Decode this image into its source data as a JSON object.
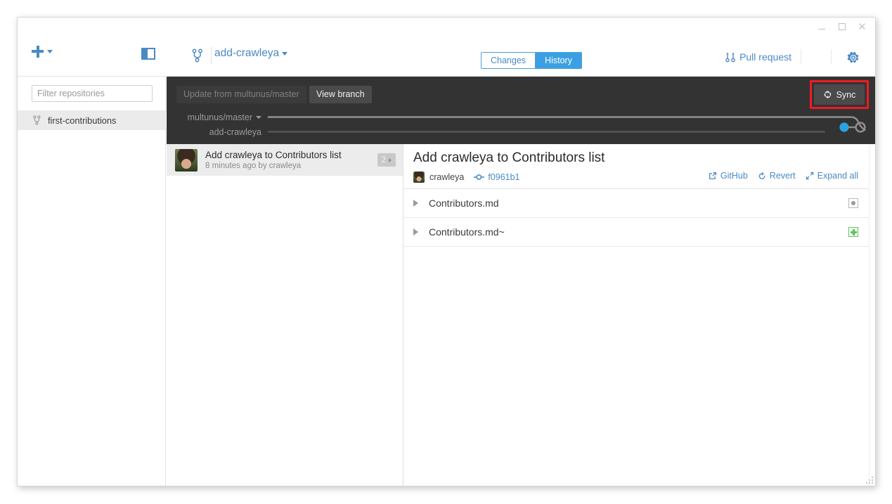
{
  "window": {
    "controls": {
      "minimize": "minimize",
      "maximize": "maximize",
      "close": "✕"
    }
  },
  "sidebar": {
    "add_repo": {
      "icon": "plus-icon",
      "caret": "chevron-down-icon"
    },
    "toggle_icon": "sidebar-toggle-icon",
    "filter": {
      "placeholder": "Filter repositories",
      "value": ""
    },
    "repos": [
      {
        "name": "first-contributions",
        "icon": "branch-icon",
        "selected": true
      }
    ]
  },
  "header": {
    "branch_icon": "branch-icon",
    "current_branch": "add-crawleya",
    "branch_caret": "chevron-down-icon",
    "tabs": [
      {
        "label": "Changes",
        "active": false
      },
      {
        "label": "History",
        "active": true
      }
    ],
    "pull_request": {
      "label": "Pull request",
      "icon": "pull-request-icon"
    },
    "settings_icon": "gear-icon"
  },
  "toolbar": {
    "update_button": {
      "label": "Update from multunus/master",
      "enabled": false
    },
    "view_branch_button": {
      "label": "View branch",
      "enabled": true
    },
    "sync_button": {
      "label": "Sync",
      "icon": "sync-icon",
      "highlighted": true,
      "highlight_color": "#ee1b24"
    }
  },
  "graph": {
    "rows": [
      {
        "label": "multunus/master",
        "has_caret": true
      },
      {
        "label": "add-crawleya",
        "has_caret": false
      }
    ],
    "commit_node_color": "#29a3e3"
  },
  "commits": [
    {
      "title": "Add crawleya to Contributors list",
      "meta": "8 minutes ago by crawleya",
      "badge": "2",
      "selected": true
    }
  ],
  "detail": {
    "title": "Add crawleya to Contributors list",
    "author": "crawleya",
    "sha": "f0961b1",
    "sha_icon": "commit-icon",
    "actions": [
      {
        "label": "GitHub",
        "icon": "external-link-icon"
      },
      {
        "label": "Revert",
        "icon": "revert-icon"
      },
      {
        "label": "Expand all",
        "icon": "expand-icon"
      }
    ],
    "files": [
      {
        "name": "Contributors.md",
        "status": "modified",
        "status_icon": "modified-icon"
      },
      {
        "name": "Contributors.md~",
        "status": "added",
        "status_icon": "added-icon"
      }
    ]
  },
  "colors": {
    "accent": "#4a8ac4",
    "tab_active": "#3ba0e3",
    "dark_bar": "#333333",
    "node_blue": "#29a3e3",
    "added_green": "#5cc15c",
    "highlight_red": "#ee1b24"
  }
}
